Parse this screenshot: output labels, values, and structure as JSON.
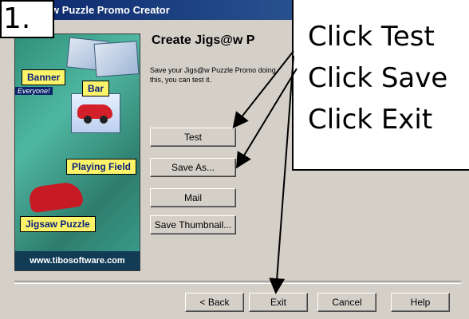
{
  "window": {
    "title": "w Puzzle Promo Creator"
  },
  "step": {
    "number": "1."
  },
  "callout": {
    "lines": [
      "Click Test",
      "Click Save",
      "Click Exit"
    ]
  },
  "image": {
    "tags": {
      "banner": "Banner",
      "bar": "Bar",
      "everyone": "Everyone!",
      "playing_field": "Playing Field",
      "jigsaw_puzzle": "Jigsaw Puzzle"
    },
    "website": "www.tibosoftware.com"
  },
  "content": {
    "heading": "Create Jigs@w P",
    "description": "Save your Jigs@w Puzzle Promo doing this, you can test it."
  },
  "buttons": {
    "test": "Test",
    "save_as": "Save As...",
    "mail": "Mail",
    "save_thumbnail": "Save Thumbnail...",
    "back": "< Back",
    "exit": "Exit",
    "cancel": "Cancel",
    "help": "Help"
  },
  "colors": {
    "titlebar": "#0a246a",
    "dialog_bg": "#d4d0c8",
    "tag_bg": "#fbf36a"
  }
}
